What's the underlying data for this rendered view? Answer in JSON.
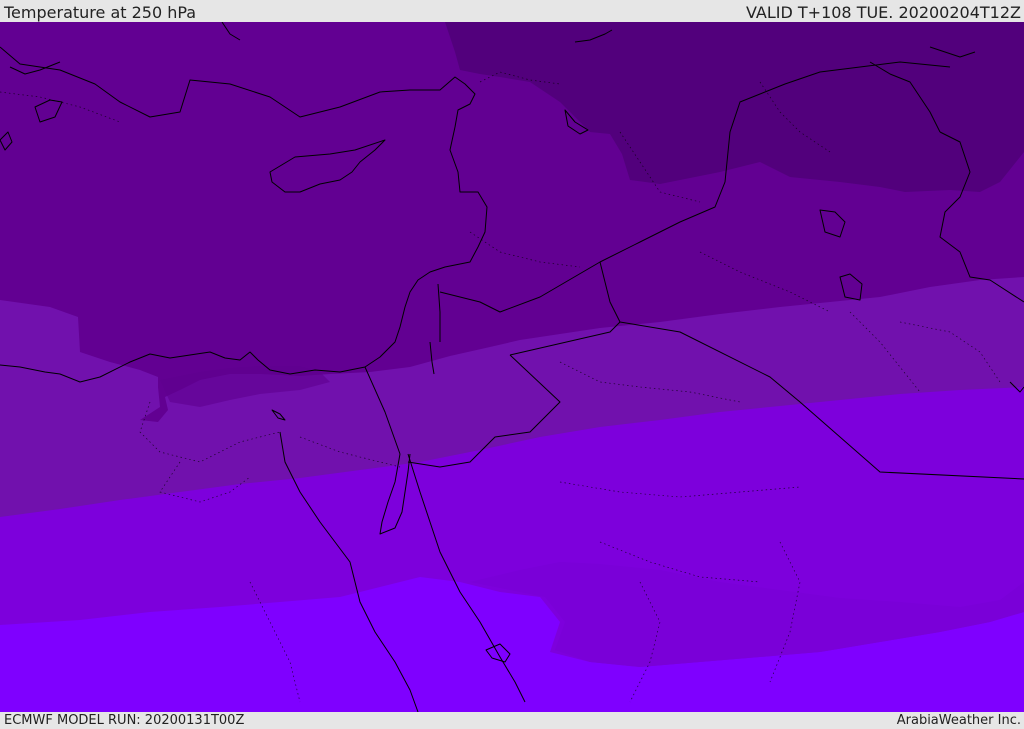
{
  "header": {
    "title": "Temperature at 250 hPa",
    "valid": "VALID T+108 TUE. 20200204T12Z"
  },
  "footer": {
    "model_run": "ECMWF MODEL RUN: 20200131T00Z",
    "credit": "ArabiaWeather Inc."
  },
  "map": {
    "variable": "temperature",
    "level": "250 hPa",
    "colors": {
      "band_coldest": "#52007c",
      "band_2": "#620092",
      "band_3": "#7111ad",
      "band_4": "#7d00dc",
      "band_warmest": "#7f00ff",
      "coastline": "#000000"
    }
  }
}
